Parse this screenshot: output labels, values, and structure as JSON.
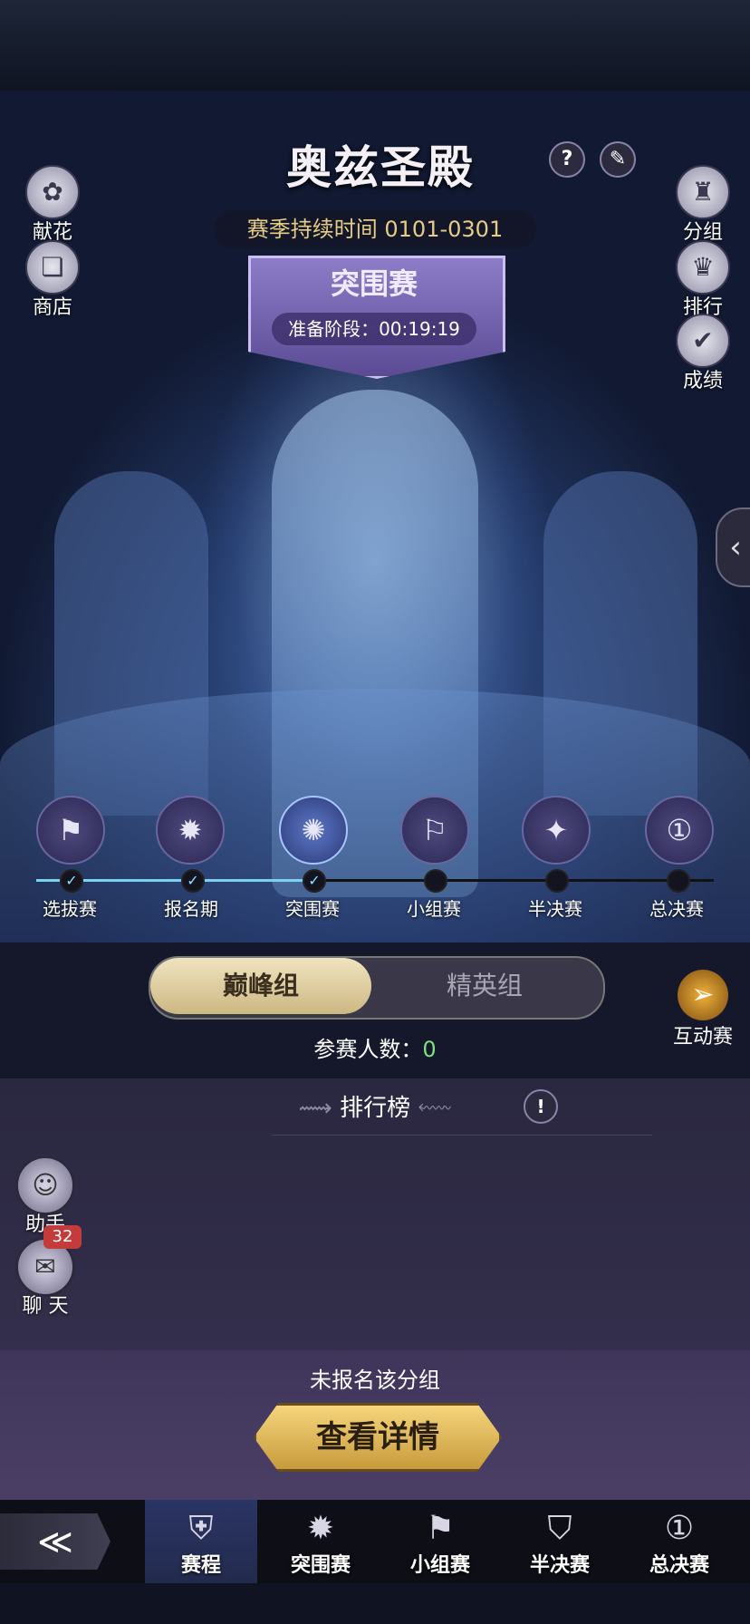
{
  "header": {
    "title": "奥兹圣殿",
    "help_icon": "?",
    "season_text": "赛季持续时间 0101-0301"
  },
  "banner": {
    "title": "突围赛",
    "phase_text": "准备阶段：00:19:19"
  },
  "left_side": [
    {
      "label": "献花",
      "icon": "rose-icon"
    },
    {
      "label": "商店",
      "icon": "shop-cards-icon"
    }
  ],
  "right_side": [
    {
      "label": "分组",
      "icon": "group-icon"
    },
    {
      "label": "排行",
      "icon": "ranking-icon"
    },
    {
      "label": "成绩",
      "icon": "results-icon"
    }
  ],
  "collapse_glyph": "‹",
  "stages": [
    {
      "label": "选拔赛",
      "done": true
    },
    {
      "label": "报名期",
      "done": true
    },
    {
      "label": "突围赛",
      "done": true
    },
    {
      "label": "小组赛",
      "done": false
    },
    {
      "label": "半决赛",
      "done": false
    },
    {
      "label": "总决赛",
      "done": false
    }
  ],
  "tabs": {
    "active": "巅峰组",
    "inactive": "精英组"
  },
  "participants": {
    "label": "参赛人数：",
    "value": "0"
  },
  "interactive_match": "互动赛",
  "leaderboard": {
    "title": "排行榜",
    "info_glyph": "!"
  },
  "helper": {
    "label": "助手"
  },
  "chat": {
    "label": "聊 天",
    "badge": "32"
  },
  "registration": {
    "status": "未报名该分组",
    "button": "查看详情"
  },
  "nav": {
    "back_glyph": "≪",
    "items": [
      {
        "label": "赛程",
        "active": true
      },
      {
        "label": "突围赛",
        "active": false
      },
      {
        "label": "小组赛",
        "active": false
      },
      {
        "label": "半决赛",
        "active": false
      },
      {
        "label": "总决赛",
        "active": false
      }
    ]
  },
  "colors": {
    "accent_gold": "#e6cd86",
    "banner_purple": "#8d7cc7",
    "progress_cyan": "#7bd1f0",
    "count_green": "#7fe07f",
    "badge_red": "#c43b3b"
  }
}
